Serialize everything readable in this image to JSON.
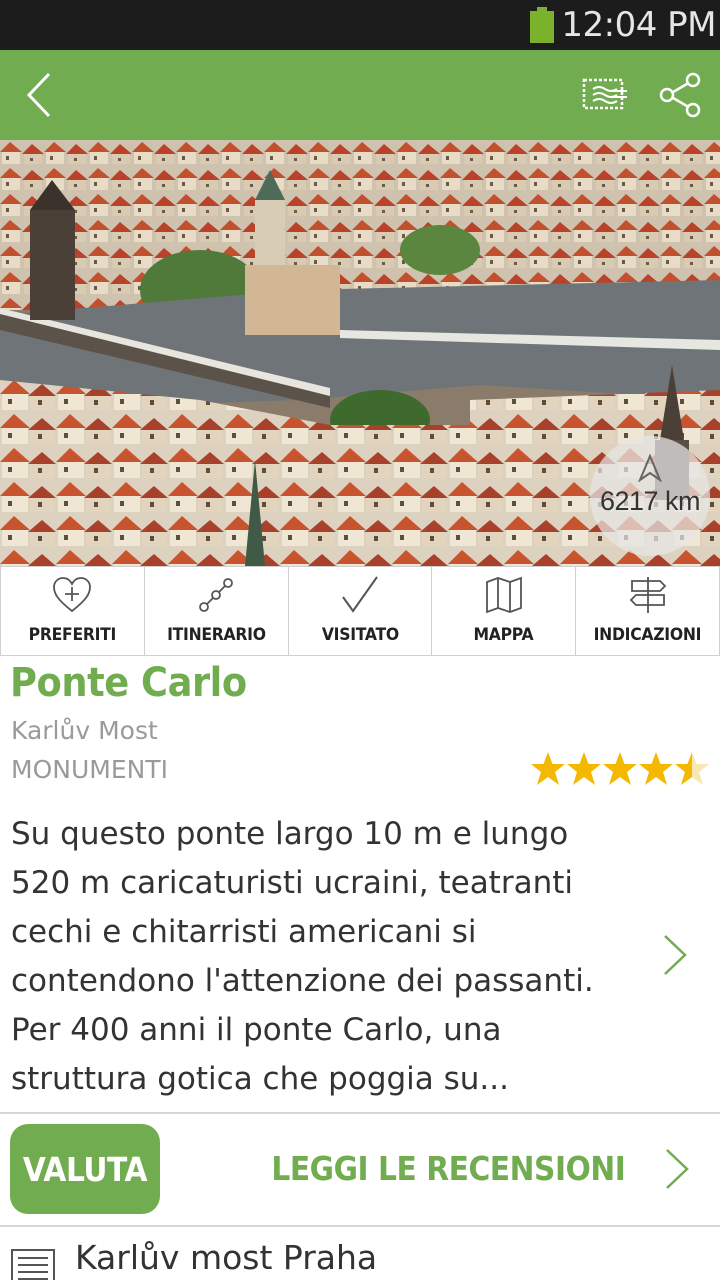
{
  "status_bar": {
    "time": "12:04 PM"
  },
  "toolbar": {
    "back_icon": "back-chevron-icon",
    "stamp_icon": "postcard-stamp-icon",
    "share_icon": "share-icon"
  },
  "hero": {
    "image": "aerial view of Prague with Charles Bridge over the Vltava river",
    "distance": "6217 km"
  },
  "actions": [
    {
      "label": "PREFERITI",
      "icon": "heart-plus-icon"
    },
    {
      "label": "ITINERARIO",
      "icon": "route-icon"
    },
    {
      "label": "VISITATO",
      "icon": "checkmark-icon"
    },
    {
      "label": "MAPPA",
      "icon": "map-icon"
    },
    {
      "label": "INDICAZIONI",
      "icon": "signpost-icon"
    }
  ],
  "place": {
    "title": "Ponte Carlo",
    "local_name": "Karlův Most",
    "category": "MONUMENTI",
    "rating": 4.5,
    "rating_max": 5,
    "description": "Su questo ponte largo 10 m e lungo 520 m caricaturisti ucraini, teatranti cechi e chitarristi americani si contendono l'attenzione dei passanti. Per 400 anni il ponte Carlo, una struttura gotica che poggia su..."
  },
  "reviews": {
    "rate_label": "VALUTA",
    "read_label": "LEGGI LE RECENSIONI"
  },
  "address": {
    "text": "Karlův most Praha"
  },
  "colors": {
    "accent": "#72ac50",
    "status_bar": "#1c1c1c",
    "star": "#f5b800"
  }
}
